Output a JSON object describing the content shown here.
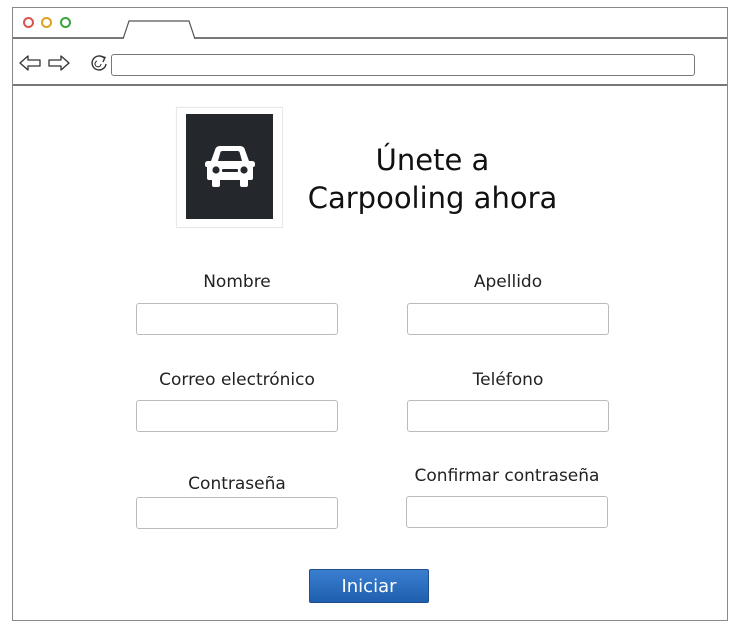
{
  "browser": {
    "url": "",
    "icons": [
      "back-arrow-icon",
      "forward-arrow-icon",
      "reload-icon"
    ],
    "window_controls": [
      {
        "name": "close",
        "color": "#d9534f"
      },
      {
        "name": "minimize",
        "color": "#e0a020"
      },
      {
        "name": "maximize",
        "color": "#3aa53a"
      }
    ]
  },
  "header": {
    "logo_icon": "car-icon",
    "logo_bg_color": "#24282c",
    "title_line1": "Únete a",
    "title_line2": "Carpooling ahora"
  },
  "form": {
    "fields": [
      {
        "label": "Nombre",
        "value": ""
      },
      {
        "label": "Apellido",
        "value": ""
      },
      {
        "label": "Correo electrónico",
        "value": ""
      },
      {
        "label": "Teléfono",
        "value": ""
      },
      {
        "label": "Contraseña",
        "value": ""
      },
      {
        "label": "Confirmar contraseña",
        "value": ""
      }
    ],
    "submit_label": "Iniciar",
    "submit_color": "#2a6cc0"
  }
}
